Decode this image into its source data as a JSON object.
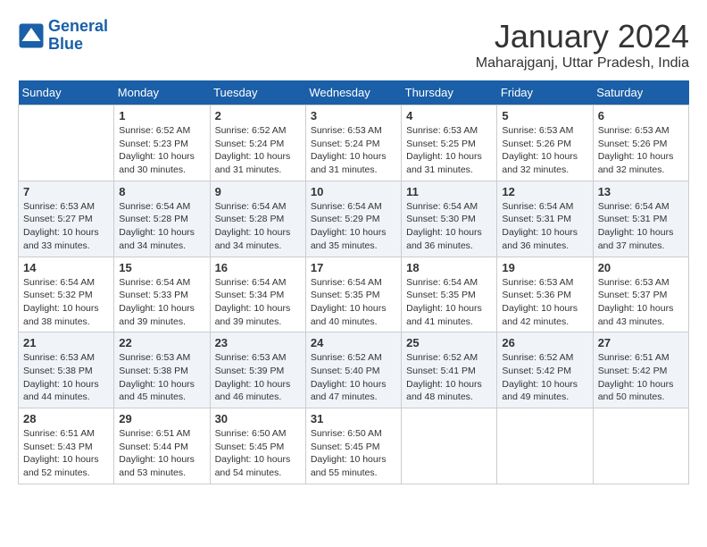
{
  "header": {
    "logo_line1": "General",
    "logo_line2": "Blue",
    "month_year": "January 2024",
    "location": "Maharajganj, Uttar Pradesh, India"
  },
  "days_of_week": [
    "Sunday",
    "Monday",
    "Tuesday",
    "Wednesday",
    "Thursday",
    "Friday",
    "Saturday"
  ],
  "weeks": [
    [
      {
        "day": "",
        "sunrise": "",
        "sunset": "",
        "daylight": ""
      },
      {
        "day": "1",
        "sunrise": "Sunrise: 6:52 AM",
        "sunset": "Sunset: 5:23 PM",
        "daylight": "Daylight: 10 hours and 30 minutes."
      },
      {
        "day": "2",
        "sunrise": "Sunrise: 6:52 AM",
        "sunset": "Sunset: 5:24 PM",
        "daylight": "Daylight: 10 hours and 31 minutes."
      },
      {
        "day": "3",
        "sunrise": "Sunrise: 6:53 AM",
        "sunset": "Sunset: 5:24 PM",
        "daylight": "Daylight: 10 hours and 31 minutes."
      },
      {
        "day": "4",
        "sunrise": "Sunrise: 6:53 AM",
        "sunset": "Sunset: 5:25 PM",
        "daylight": "Daylight: 10 hours and 31 minutes."
      },
      {
        "day": "5",
        "sunrise": "Sunrise: 6:53 AM",
        "sunset": "Sunset: 5:26 PM",
        "daylight": "Daylight: 10 hours and 32 minutes."
      },
      {
        "day": "6",
        "sunrise": "Sunrise: 6:53 AM",
        "sunset": "Sunset: 5:26 PM",
        "daylight": "Daylight: 10 hours and 32 minutes."
      }
    ],
    [
      {
        "day": "7",
        "sunrise": "Sunrise: 6:53 AM",
        "sunset": "Sunset: 5:27 PM",
        "daylight": "Daylight: 10 hours and 33 minutes."
      },
      {
        "day": "8",
        "sunrise": "Sunrise: 6:54 AM",
        "sunset": "Sunset: 5:28 PM",
        "daylight": "Daylight: 10 hours and 34 minutes."
      },
      {
        "day": "9",
        "sunrise": "Sunrise: 6:54 AM",
        "sunset": "Sunset: 5:28 PM",
        "daylight": "Daylight: 10 hours and 34 minutes."
      },
      {
        "day": "10",
        "sunrise": "Sunrise: 6:54 AM",
        "sunset": "Sunset: 5:29 PM",
        "daylight": "Daylight: 10 hours and 35 minutes."
      },
      {
        "day": "11",
        "sunrise": "Sunrise: 6:54 AM",
        "sunset": "Sunset: 5:30 PM",
        "daylight": "Daylight: 10 hours and 36 minutes."
      },
      {
        "day": "12",
        "sunrise": "Sunrise: 6:54 AM",
        "sunset": "Sunset: 5:31 PM",
        "daylight": "Daylight: 10 hours and 36 minutes."
      },
      {
        "day": "13",
        "sunrise": "Sunrise: 6:54 AM",
        "sunset": "Sunset: 5:31 PM",
        "daylight": "Daylight: 10 hours and 37 minutes."
      }
    ],
    [
      {
        "day": "14",
        "sunrise": "Sunrise: 6:54 AM",
        "sunset": "Sunset: 5:32 PM",
        "daylight": "Daylight: 10 hours and 38 minutes."
      },
      {
        "day": "15",
        "sunrise": "Sunrise: 6:54 AM",
        "sunset": "Sunset: 5:33 PM",
        "daylight": "Daylight: 10 hours and 39 minutes."
      },
      {
        "day": "16",
        "sunrise": "Sunrise: 6:54 AM",
        "sunset": "Sunset: 5:34 PM",
        "daylight": "Daylight: 10 hours and 39 minutes."
      },
      {
        "day": "17",
        "sunrise": "Sunrise: 6:54 AM",
        "sunset": "Sunset: 5:35 PM",
        "daylight": "Daylight: 10 hours and 40 minutes."
      },
      {
        "day": "18",
        "sunrise": "Sunrise: 6:54 AM",
        "sunset": "Sunset: 5:35 PM",
        "daylight": "Daylight: 10 hours and 41 minutes."
      },
      {
        "day": "19",
        "sunrise": "Sunrise: 6:53 AM",
        "sunset": "Sunset: 5:36 PM",
        "daylight": "Daylight: 10 hours and 42 minutes."
      },
      {
        "day": "20",
        "sunrise": "Sunrise: 6:53 AM",
        "sunset": "Sunset: 5:37 PM",
        "daylight": "Daylight: 10 hours and 43 minutes."
      }
    ],
    [
      {
        "day": "21",
        "sunrise": "Sunrise: 6:53 AM",
        "sunset": "Sunset: 5:38 PM",
        "daylight": "Daylight: 10 hours and 44 minutes."
      },
      {
        "day": "22",
        "sunrise": "Sunrise: 6:53 AM",
        "sunset": "Sunset: 5:38 PM",
        "daylight": "Daylight: 10 hours and 45 minutes."
      },
      {
        "day": "23",
        "sunrise": "Sunrise: 6:53 AM",
        "sunset": "Sunset: 5:39 PM",
        "daylight": "Daylight: 10 hours and 46 minutes."
      },
      {
        "day": "24",
        "sunrise": "Sunrise: 6:52 AM",
        "sunset": "Sunset: 5:40 PM",
        "daylight": "Daylight: 10 hours and 47 minutes."
      },
      {
        "day": "25",
        "sunrise": "Sunrise: 6:52 AM",
        "sunset": "Sunset: 5:41 PM",
        "daylight": "Daylight: 10 hours and 48 minutes."
      },
      {
        "day": "26",
        "sunrise": "Sunrise: 6:52 AM",
        "sunset": "Sunset: 5:42 PM",
        "daylight": "Daylight: 10 hours and 49 minutes."
      },
      {
        "day": "27",
        "sunrise": "Sunrise: 6:51 AM",
        "sunset": "Sunset: 5:42 PM",
        "daylight": "Daylight: 10 hours and 50 minutes."
      }
    ],
    [
      {
        "day": "28",
        "sunrise": "Sunrise: 6:51 AM",
        "sunset": "Sunset: 5:43 PM",
        "daylight": "Daylight: 10 hours and 52 minutes."
      },
      {
        "day": "29",
        "sunrise": "Sunrise: 6:51 AM",
        "sunset": "Sunset: 5:44 PM",
        "daylight": "Daylight: 10 hours and 53 minutes."
      },
      {
        "day": "30",
        "sunrise": "Sunrise: 6:50 AM",
        "sunset": "Sunset: 5:45 PM",
        "daylight": "Daylight: 10 hours and 54 minutes."
      },
      {
        "day": "31",
        "sunrise": "Sunrise: 6:50 AM",
        "sunset": "Sunset: 5:45 PM",
        "daylight": "Daylight: 10 hours and 55 minutes."
      },
      {
        "day": "",
        "sunrise": "",
        "sunset": "",
        "daylight": ""
      },
      {
        "day": "",
        "sunrise": "",
        "sunset": "",
        "daylight": ""
      },
      {
        "day": "",
        "sunrise": "",
        "sunset": "",
        "daylight": ""
      }
    ]
  ]
}
